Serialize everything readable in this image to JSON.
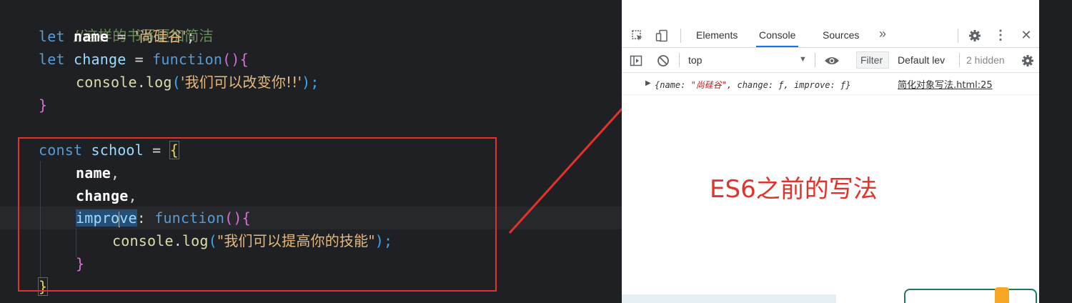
{
  "editor": {
    "lines": {
      "l1_comment": "//这样的书写更加简洁",
      "l2_kw": "let",
      "l2_name": "name",
      "l2_eq": " = ",
      "l2_str": "'尚硅谷'",
      "l2_semi": ";",
      "l3_kw": "let",
      "l3_name": "change",
      "l3_eq": " = ",
      "l3_fn": "function",
      "l3_paren": "()",
      "l3_brace": "{",
      "l4_obj": "console",
      "l4_dot": ".",
      "l4_method": "log",
      "l4_open": "(",
      "l4_str": "'我们可以改变你!!'",
      "l4_close": ");",
      "l5_brace": "}",
      "l7_kw": "const",
      "l7_name": "school",
      "l7_eq": " = ",
      "l7_brace": "{",
      "l8_prop": "name",
      "l8_comma": ",",
      "l9_prop": "change",
      "l9_comma": ",",
      "l10_prop_a": "impro",
      "l10_prop_b": "ve",
      "l10_colon": ": ",
      "l10_fn": "function",
      "l10_paren": "()",
      "l10_brace": "{",
      "l11_obj": "console",
      "l11_dot": ".",
      "l11_method": "log",
      "l11_open": "(",
      "l11_str": "\"我们可以提高你的技能\"",
      "l11_close": ");",
      "l12_brace": "}",
      "l13_brace": "}"
    }
  },
  "devtools": {
    "tabs": {
      "elements": "Elements",
      "console": "Console",
      "sources": "Sources",
      "more": "»"
    },
    "toolbar": {
      "context": "top",
      "context_arrow": "▼",
      "filter_placeholder": "Filter",
      "levels": "Default lev",
      "hidden": "2 hidden"
    },
    "console_output": {
      "expand_arrow": "▶",
      "pre": "{name: ",
      "str": "\"尚硅谷\"",
      "post": ", change: ƒ, improve: ƒ}",
      "source": "简化对象写法.html:25"
    }
  },
  "annotation": "ES6之前的写法",
  "colors": {
    "highlight": "#e4322b",
    "active_tab": "#1a73e8"
  },
  "icons": [
    "inspect-icon",
    "device-toolbar-icon",
    "gear-icon",
    "kebab-menu-icon",
    "close-icon",
    "sidebar-toggle-icon",
    "clear-console-icon",
    "eye-icon"
  ]
}
